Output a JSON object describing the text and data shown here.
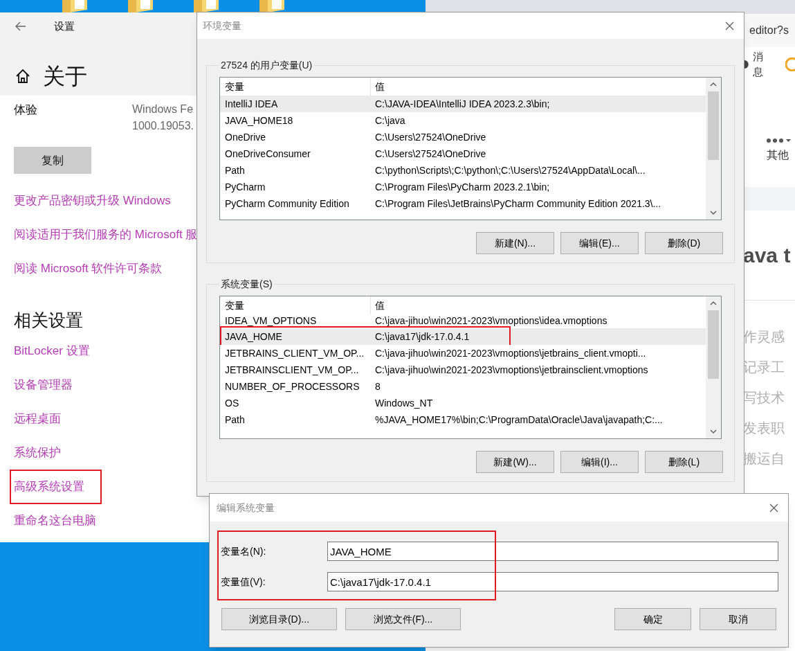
{
  "settings": {
    "title": "设置",
    "heading": "关于",
    "spec_row": {
      "label": "体验",
      "value_lines": [
        "Windows Fe",
        "1000.19053."
      ]
    },
    "copy_button": "复制",
    "links": [
      {
        "label": "更改产品密钥或升级 Windows"
      },
      {
        "label": "阅读适用于我们服务的 Microsoft 服"
      },
      {
        "label": "阅读 Microsoft 软件许可条款"
      }
    ],
    "related_heading": "相关设置",
    "related_links": [
      {
        "label": "BitLocker 设置",
        "highlighted": false
      },
      {
        "label": "设备管理器",
        "highlighted": false
      },
      {
        "label": "远程桌面",
        "highlighted": false
      },
      {
        "label": "系统保护",
        "highlighted": false
      },
      {
        "label": "高级系统设置",
        "highlighted": true
      },
      {
        "label": "重命名这台电脑",
        "highlighted": false
      }
    ]
  },
  "browser": {
    "address": "editor?s",
    "message_label": "消息",
    "more_label": "其他",
    "heading": "ava t",
    "lines": [
      "作灵感",
      "记录工",
      "写技术",
      "发表职",
      "搬运自"
    ]
  },
  "env_dialog": {
    "title": "环境变量",
    "groups": [
      {
        "title": "27524 的用户变量(U)",
        "columns": [
          "变量",
          "值"
        ],
        "rows": [
          {
            "name": "IntelliJ IDEA",
            "value": "C:\\JAVA-IDEA\\IntelliJ IDEA 2023.2.3\\bin;",
            "selected": true,
            "highlighted": false
          },
          {
            "name": "JAVA_HOME18",
            "value": "C:\\java",
            "selected": false,
            "highlighted": false
          },
          {
            "name": "OneDrive",
            "value": "C:\\Users\\27524\\OneDrive",
            "selected": false,
            "highlighted": false
          },
          {
            "name": "OneDriveConsumer",
            "value": "C:\\Users\\27524\\OneDrive",
            "selected": false,
            "highlighted": false
          },
          {
            "name": "Path",
            "value": "C:\\python\\Scripts\\;C:\\python\\;C:\\Users\\27524\\AppData\\Local\\...",
            "selected": false,
            "highlighted": false
          },
          {
            "name": "PyCharm",
            "value": "C:\\Program Files\\PyCharm 2023.2.1\\bin;",
            "selected": false,
            "highlighted": false
          },
          {
            "name": "PyCharm Community Edition",
            "value": "C:\\Program Files\\JetBrains\\PyCharm Community Edition 2021.3\\...",
            "selected": false,
            "highlighted": false
          }
        ],
        "buttons": [
          "新建(N)...",
          "编辑(E)...",
          "删除(D)"
        ]
      },
      {
        "title": "系统变量(S)",
        "columns": [
          "变量",
          "值"
        ],
        "rows": [
          {
            "name": "IDEA_VM_OPTIONS",
            "value": "C:\\java-jihuo\\win2021-2023\\vmoptions\\idea.vmoptions",
            "selected": false,
            "highlighted": false
          },
          {
            "name": "JAVA_HOME",
            "value": "C:\\java17\\jdk-17.0.4.1",
            "selected": true,
            "highlighted": true
          },
          {
            "name": "JETBRAINS_CLIENT_VM_OP...",
            "value": "C:\\java-jihuo\\win2021-2023\\vmoptions\\jetbrains_client.vmopti...",
            "selected": false,
            "highlighted": false
          },
          {
            "name": "JETBRAINSCLIENT_VM_OP...",
            "value": "C:\\java-jihuo\\win2021-2023\\vmoptions\\jetbrainsclient.vmoptions",
            "selected": false,
            "highlighted": false
          },
          {
            "name": "NUMBER_OF_PROCESSORS",
            "value": "8",
            "selected": false,
            "highlighted": false
          },
          {
            "name": "OS",
            "value": "Windows_NT",
            "selected": false,
            "highlighted": false
          },
          {
            "name": "Path",
            "value": "%JAVA_HOME17%\\bin;C:\\ProgramData\\Oracle\\Java\\javapath;C:...",
            "selected": false,
            "highlighted": false
          }
        ],
        "buttons": [
          "新建(W)...",
          "编辑(I)...",
          "删除(L)"
        ]
      }
    ]
  },
  "edit_dialog": {
    "title": "编辑系统变量",
    "highlighted": true,
    "fields": [
      {
        "label": "变量名(N):",
        "value": "JAVA_HOME"
      },
      {
        "label": "变量值(V):",
        "value": "C:\\java17\\jdk-17.0.4.1"
      }
    ],
    "left_buttons": [
      "浏览目录(D)...",
      "浏览文件(F)..."
    ],
    "right_buttons": [
      "确定",
      "取消"
    ]
  }
}
